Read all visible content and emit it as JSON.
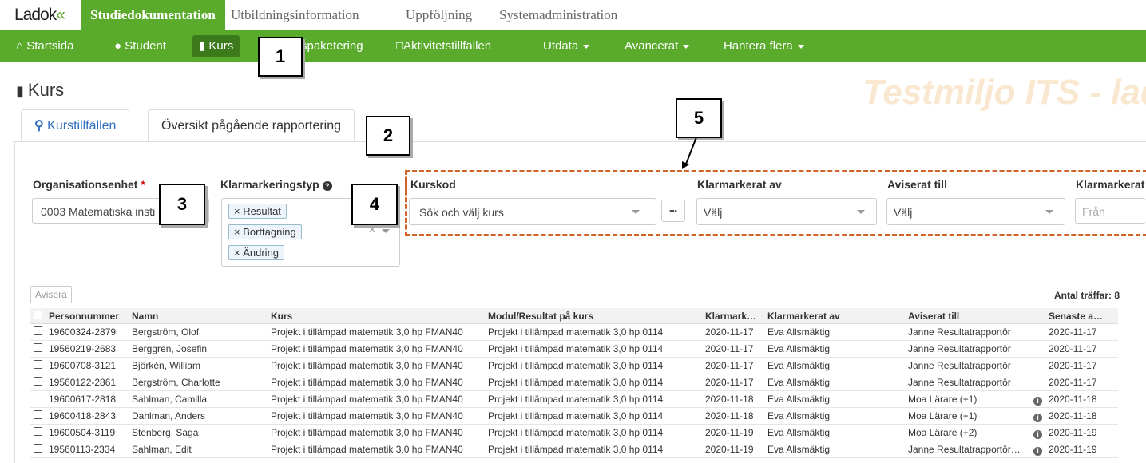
{
  "logo": {
    "text": "Ladok",
    "mark": "«"
  },
  "top_tabs": [
    "Studiedokumentation",
    "Utbildningsinformation",
    "Uppföljning",
    "Systemadministration"
  ],
  "nav": {
    "startsida": "Startsida",
    "student": "Student",
    "kurs": "Kurs",
    "kurspaketering": "rspaketering",
    "aktivitet": "Aktivitetstillfällen",
    "utdata": "Utdata",
    "avancerat": "Avancerat",
    "hantera": "Hantera flera"
  },
  "callouts": [
    "1",
    "2",
    "3",
    "4",
    "5"
  ],
  "page_title": "Kurs",
  "watermark": "Testmiljo ITS - lad",
  "tabs": {
    "kurstillfallen": "Kurstillfällen",
    "oversikt": "Översikt pågående rapportering"
  },
  "filters": {
    "org_label": "Organisationsenhet",
    "org_required": "*",
    "org_value": "0003 Matematiska insti",
    "typ_label": "Klarmarkeringstyp",
    "typ_tags": [
      "Resultat",
      "Borttagning",
      "Ändring"
    ],
    "tag_remove": "×",
    "kurskod_label": "Kurskod",
    "kurskod_placeholder": "Sök och välj kurs",
    "more_button": "•••",
    "klarmarkerat_av_label": "Klarmarkerat av",
    "klarmarkerat_av_value": "Välj",
    "aviserat_till_label": "Aviserat till",
    "aviserat_till_value": "Välj",
    "klarmarkerat_label": "Klarmarkerat",
    "klarmarkerat_from": "Från"
  },
  "avisera_button": "Avisera",
  "hits": "Antal träffar: 8",
  "table": {
    "headers": [
      "Personnummer",
      "Namn",
      "Kurs",
      "Modul/Resultat på kurs",
      "Klarmark…",
      "Klarmarkerat av",
      "Aviserat till",
      "Senaste a…"
    ],
    "rows": [
      [
        "19600324-2879",
        "Bergström, Olof",
        "Projekt i tillämpad matematik 3,0 hp FMAN40",
        "Projekt i tillämpad matematik 3,0 hp 0114",
        "2020-11-17",
        "Eva Allsmäktig",
        "Janne Resultatrapportör",
        "2020-11-17",
        false
      ],
      [
        "19560219-2683",
        "Berggren, Josefin",
        "Projekt i tillämpad matematik 3,0 hp FMAN40",
        "Projekt i tillämpad matematik 3,0 hp 0114",
        "2020-11-17",
        "Eva Allsmäktig",
        "Janne Resultatrapportör",
        "2020-11-17",
        false
      ],
      [
        "19600708-3121",
        "Björkén, William",
        "Projekt i tillämpad matematik 3,0 hp FMAN40",
        "Projekt i tillämpad matematik 3,0 hp 0114",
        "2020-11-17",
        "Eva Allsmäktig",
        "Janne Resultatrapportör",
        "2020-11-17",
        false
      ],
      [
        "19560122-2861",
        "Bergström, Charlotte",
        "Projekt i tillämpad matematik 3,0 hp FMAN40",
        "Projekt i tillämpad matematik 3,0 hp 0114",
        "2020-11-17",
        "Eva Allsmäktig",
        "Janne Resultatrapportör",
        "2020-11-17",
        false
      ],
      [
        "19600617-2818",
        "Sahlman, Camilla",
        "Projekt i tillämpad matematik 3,0 hp FMAN40",
        "Projekt i tillämpad matematik 3,0 hp 0114",
        "2020-11-18",
        "Eva Allsmäktig",
        "Moa Lärare (+1)",
        "2020-11-18",
        true
      ],
      [
        "19600418-2843",
        "Dahlman, Anders",
        "Projekt i tillämpad matematik 3,0 hp FMAN40",
        "Projekt i tillämpad matematik 3,0 hp 0114",
        "2020-11-18",
        "Eva Allsmäktig",
        "Moa Lärare (+1)",
        "2020-11-18",
        true
      ],
      [
        "19600504-3119",
        "Stenberg, Saga",
        "Projekt i tillämpad matematik 3,0 hp FMAN40",
        "Projekt i tillämpad matematik 3,0 hp 0114",
        "2020-11-19",
        "Eva Allsmäktig",
        "Moa Lärare (+2)",
        "2020-11-19",
        true
      ],
      [
        "19560113-2334",
        "Sahlman, Edit",
        "Projekt i tillämpad matematik 3,0 hp FMAN40",
        "Projekt i tillämpad matematik 3,0 hp 0114",
        "2020-11-19",
        "Eva Allsmäktig",
        "Janne Resultatrapportör…",
        "2020-11-19",
        true
      ]
    ]
  },
  "colors": {
    "brand_green": "#5aaa2b",
    "nav_active": "#3d7a1b",
    "highlight": "#d0622a",
    "link_blue": "#2f6fbf"
  }
}
